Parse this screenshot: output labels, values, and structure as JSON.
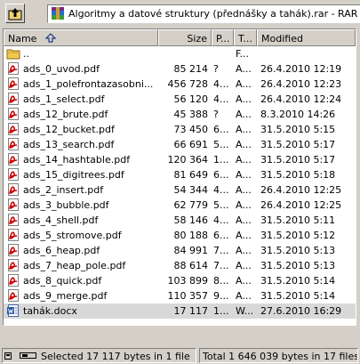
{
  "path": {
    "text": "Algoritmy a datové struktury (přednášky a tahák).rar - RAR arc"
  },
  "columns": {
    "name": "Name",
    "size": "Size",
    "packed": "P...",
    "type": "T...",
    "modified": "Modified"
  },
  "files": [
    {
      "name": "..",
      "size": "",
      "packed": "",
      "type": "F...",
      "modified": "",
      "icon": "folder-icon"
    },
    {
      "name": "ads_0_uvod.pdf",
      "size": "85 214",
      "packed": "?",
      "type": "A...",
      "modified": "26.4.2010 12:19",
      "icon": "pdf-icon"
    },
    {
      "name": "ads_1_polefrontazasobni...",
      "size": "456 728",
      "packed": "4...",
      "type": "A...",
      "modified": "26.4.2010 12:23",
      "icon": "pdf-icon"
    },
    {
      "name": "ads_1_select.pdf",
      "size": "56 120",
      "packed": "4...",
      "type": "A...",
      "modified": "26.4.2010 12:24",
      "icon": "pdf-icon"
    },
    {
      "name": "ads_12_brute.pdf",
      "size": "45 388",
      "packed": "?",
      "type": "A...",
      "modified": "8.3.2010 14:26",
      "icon": "pdf-icon"
    },
    {
      "name": "ads_12_bucket.pdf",
      "size": "73 450",
      "packed": "6...",
      "type": "A...",
      "modified": "31.5.2010 5:15",
      "icon": "pdf-icon"
    },
    {
      "name": "ads_13_search.pdf",
      "size": "66 691",
      "packed": "5...",
      "type": "A...",
      "modified": "31.5.2010 5:17",
      "icon": "pdf-icon"
    },
    {
      "name": "ads_14_hashtable.pdf",
      "size": "120 364",
      "packed": "1...",
      "type": "A...",
      "modified": "31.5.2010 5:17",
      "icon": "pdf-icon"
    },
    {
      "name": "ads_15_digitrees.pdf",
      "size": "81 649",
      "packed": "6...",
      "type": "A...",
      "modified": "31.5.2010 5:18",
      "icon": "pdf-icon"
    },
    {
      "name": "ads_2_insert.pdf",
      "size": "54 344",
      "packed": "4...",
      "type": "A...",
      "modified": "26.4.2010 12:25",
      "icon": "pdf-icon"
    },
    {
      "name": "ads_3_bubble.pdf",
      "size": "62 779",
      "packed": "5...",
      "type": "A...",
      "modified": "26.4.2010 12:25",
      "icon": "pdf-icon"
    },
    {
      "name": "ads_4_shell.pdf",
      "size": "58 146",
      "packed": "4...",
      "type": "A...",
      "modified": "31.5.2010 5:11",
      "icon": "pdf-icon"
    },
    {
      "name": "ads_5_stromove.pdf",
      "size": "80 188",
      "packed": "6...",
      "type": "A...",
      "modified": "31.5.2010 5:12",
      "icon": "pdf-icon"
    },
    {
      "name": "ads_6_heap.pdf",
      "size": "84 991",
      "packed": "7...",
      "type": "A...",
      "modified": "31.5.2010 5:13",
      "icon": "pdf-icon"
    },
    {
      "name": "ads_7_heap_pole.pdf",
      "size": "88 614",
      "packed": "7...",
      "type": "A...",
      "modified": "31.5.2010 5:13",
      "icon": "pdf-icon"
    },
    {
      "name": "ads_8_quick.pdf",
      "size": "103 899",
      "packed": "8...",
      "type": "A...",
      "modified": "31.5.2010 5:14",
      "icon": "pdf-icon"
    },
    {
      "name": "ads_9_merge.pdf",
      "size": "110 357",
      "packed": "9...",
      "type": "A...",
      "modified": "31.5.2010 5:14",
      "icon": "pdf-icon"
    },
    {
      "name": "tahák.docx",
      "size": "17 117",
      "packed": "1...",
      "type": "W...",
      "modified": "27.6.2010 16:29",
      "icon": "docx-icon",
      "selected": true
    }
  ],
  "status": {
    "selected": "Selected 17 117 bytes in 1 file",
    "total": "Total 1 646 039 bytes in 17 files"
  },
  "colors": {
    "selected_row": "#d8d8d8",
    "pdf_red": "#cc0000",
    "folder_yellow": "#f0c850",
    "docx_blue": "#2a5aa8"
  }
}
